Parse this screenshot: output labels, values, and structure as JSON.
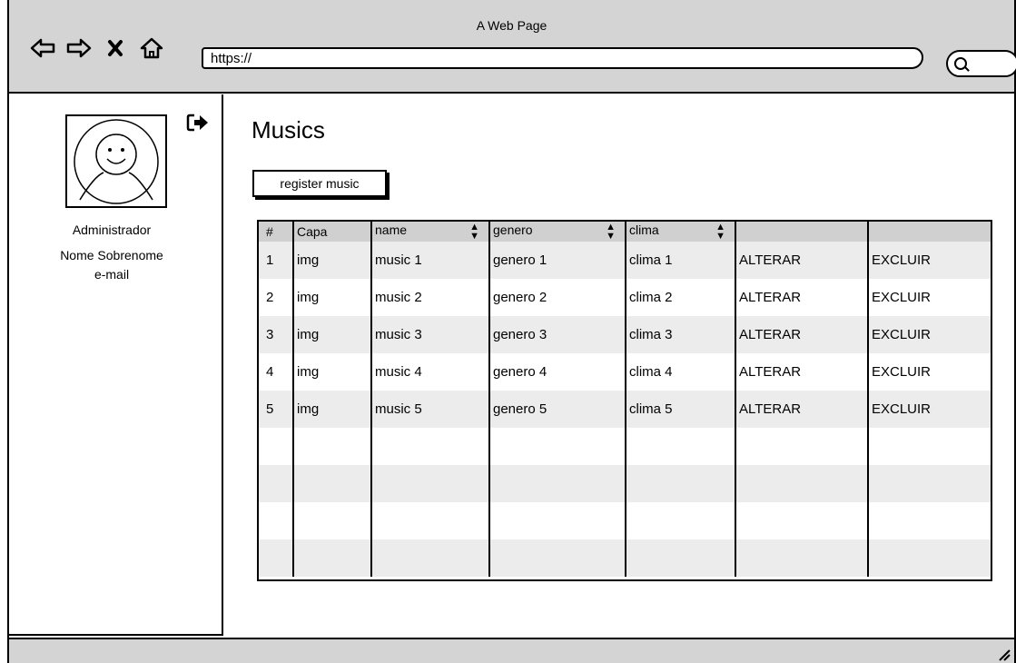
{
  "window": {
    "title": "A Web Page",
    "url": "https://"
  },
  "sidebar": {
    "role": "Administrador",
    "name": "Nome Sobrenome",
    "email": "e-mail"
  },
  "main": {
    "title": "Musics",
    "register_label": "register music"
  },
  "table": {
    "headers": [
      "#",
      "Capa",
      "name",
      "genero",
      "clima",
      "",
      ""
    ],
    "rows": [
      [
        "1",
        "img",
        "music 1",
        "genero 1",
        "clima 1",
        "ALTERAR",
        "EXCLUIR"
      ],
      [
        "2",
        "img",
        "music 2",
        "genero 2",
        "clima 2",
        "ALTERAR",
        "EXCLUIR"
      ],
      [
        "3",
        "img",
        "music 3",
        "genero 3",
        "clima 3",
        "ALTERAR",
        "EXCLUIR"
      ],
      [
        "4",
        "img",
        "music 4",
        "genero 4",
        "clima 4",
        "ALTERAR",
        "EXCLUIR"
      ],
      [
        "5",
        "img",
        "music 5",
        "genero 5",
        "clima 5",
        "ALTERAR",
        "EXCLUIR"
      ]
    ],
    "empty_rows": 4
  },
  "icons": {
    "back": "arrow-left-icon",
    "forward": "arrow-right-icon",
    "stop": "close-icon",
    "home": "home-icon",
    "search": "search-icon",
    "logout": "logout-icon",
    "avatar": "user-avatar-icon",
    "sort": "sort-icon"
  },
  "colors": {
    "chrome": "#d4d4d4",
    "table_header": "#d0d0d0",
    "row_alt": "#ececec"
  }
}
